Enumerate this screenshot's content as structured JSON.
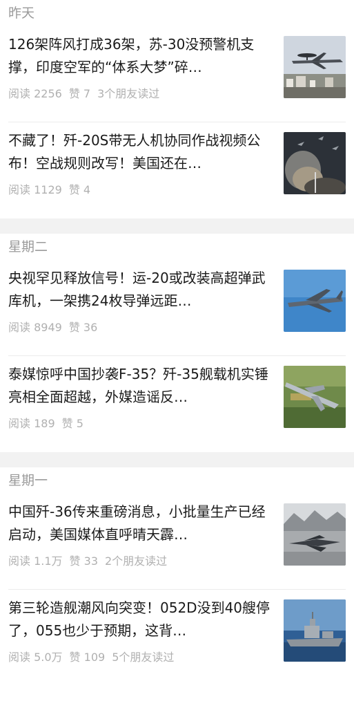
{
  "groups": [
    {
      "label": "昨天",
      "articles": [
        {
          "title": "126架阵风打成36架，苏-30没预警机支撑，印度空军的“体系大梦”碎…",
          "reads": "阅读 2256",
          "likes": "赞 7",
          "friends": "3个朋友读过",
          "image": "awacs-plane-photo"
        },
        {
          "title": "不藏了！歼-20S带无人机协同作战视频公布！空战规则改写！美国还在…",
          "reads": "阅读 1129",
          "likes": "赞 4",
          "friends": "",
          "image": "fighter-formation-photo"
        }
      ]
    },
    {
      "label": "星期二",
      "articles": [
        {
          "title": "央视罕见释放信号！运-20或改装高超弹武库机，一架携24枚导弹远距…",
          "reads": "阅读 8949",
          "likes": "赞 36",
          "friends": "",
          "image": "transport-plane-photo"
        },
        {
          "title": "泰媒惊呼中国抄袭F-35？歼-35舰载机实锤亮相全面超越，外媒造谣反…",
          "reads": "阅读 189",
          "likes": "赞 5",
          "friends": "",
          "image": "stealth-fighter-photo"
        }
      ]
    },
    {
      "label": "星期一",
      "articles": [
        {
          "title": "中国歼-36传来重磅消息，小批量生产已经启动，美国媒体直呼晴天霹…",
          "reads": "阅读 1.1万",
          "likes": "赞 33",
          "friends": "2个朋友读过",
          "image": "jet-on-runway-photo"
        },
        {
          "title": "第三轮造舰潮风向突变！052D没到40艘停了，055也少于预期，这背…",
          "reads": "阅读 5.0万",
          "likes": "赞 109",
          "friends": "5个朋友读过",
          "image": "warship-photo"
        }
      ]
    }
  ]
}
